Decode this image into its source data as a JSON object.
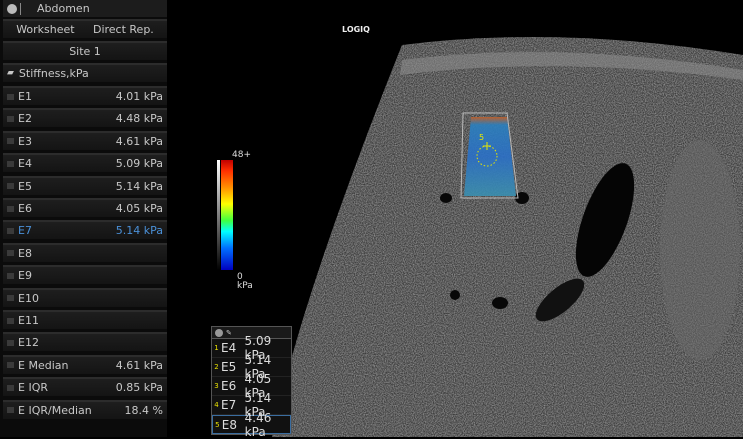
{
  "sidebar": {
    "title": "Abdomen",
    "worksheet": "Worksheet",
    "direct_rep": "Direct Rep.",
    "site": "Site 1",
    "group": "Stiffness,kPa",
    "items": [
      {
        "label": "E1",
        "value": "4.01 kPa"
      },
      {
        "label": "E2",
        "value": "4.48 kPa"
      },
      {
        "label": "E3",
        "value": "4.61 kPa"
      },
      {
        "label": "E4",
        "value": "5.09 kPa"
      },
      {
        "label": "E5",
        "value": "5.14 kPa"
      },
      {
        "label": "E6",
        "value": "4.05 kPa"
      },
      {
        "label": "E7",
        "value": "5.14 kPa",
        "selected": true
      },
      {
        "label": "E8",
        "value": ""
      },
      {
        "label": "E9",
        "value": ""
      },
      {
        "label": "E10",
        "value": ""
      },
      {
        "label": "E11",
        "value": ""
      },
      {
        "label": "E12",
        "value": ""
      },
      {
        "label": "E Median",
        "value": "4.61 kPa"
      },
      {
        "label": "E IQR",
        "value": "0.85 kPa"
      },
      {
        "label": "E IQR/Median",
        "value": "18.4 %"
      }
    ]
  },
  "image": {
    "logo": "LOGIQ",
    "roi_marker": "5"
  },
  "colorbar": {
    "max": "48+",
    "min": "0",
    "unit": "kPa"
  },
  "measure_table": {
    "header": "✎",
    "rows": [
      {
        "n": "1",
        "label": "E4",
        "value": "5.09 kPa"
      },
      {
        "n": "2",
        "label": "E5",
        "value": "5.14 kPa"
      },
      {
        "n": "3",
        "label": "E6",
        "value": "4.05 kPa"
      },
      {
        "n": "4",
        "label": "E7",
        "value": "5.14 kPa"
      },
      {
        "n": "5",
        "label": "E8",
        "value": "4.46 kPa",
        "active": true
      }
    ]
  }
}
